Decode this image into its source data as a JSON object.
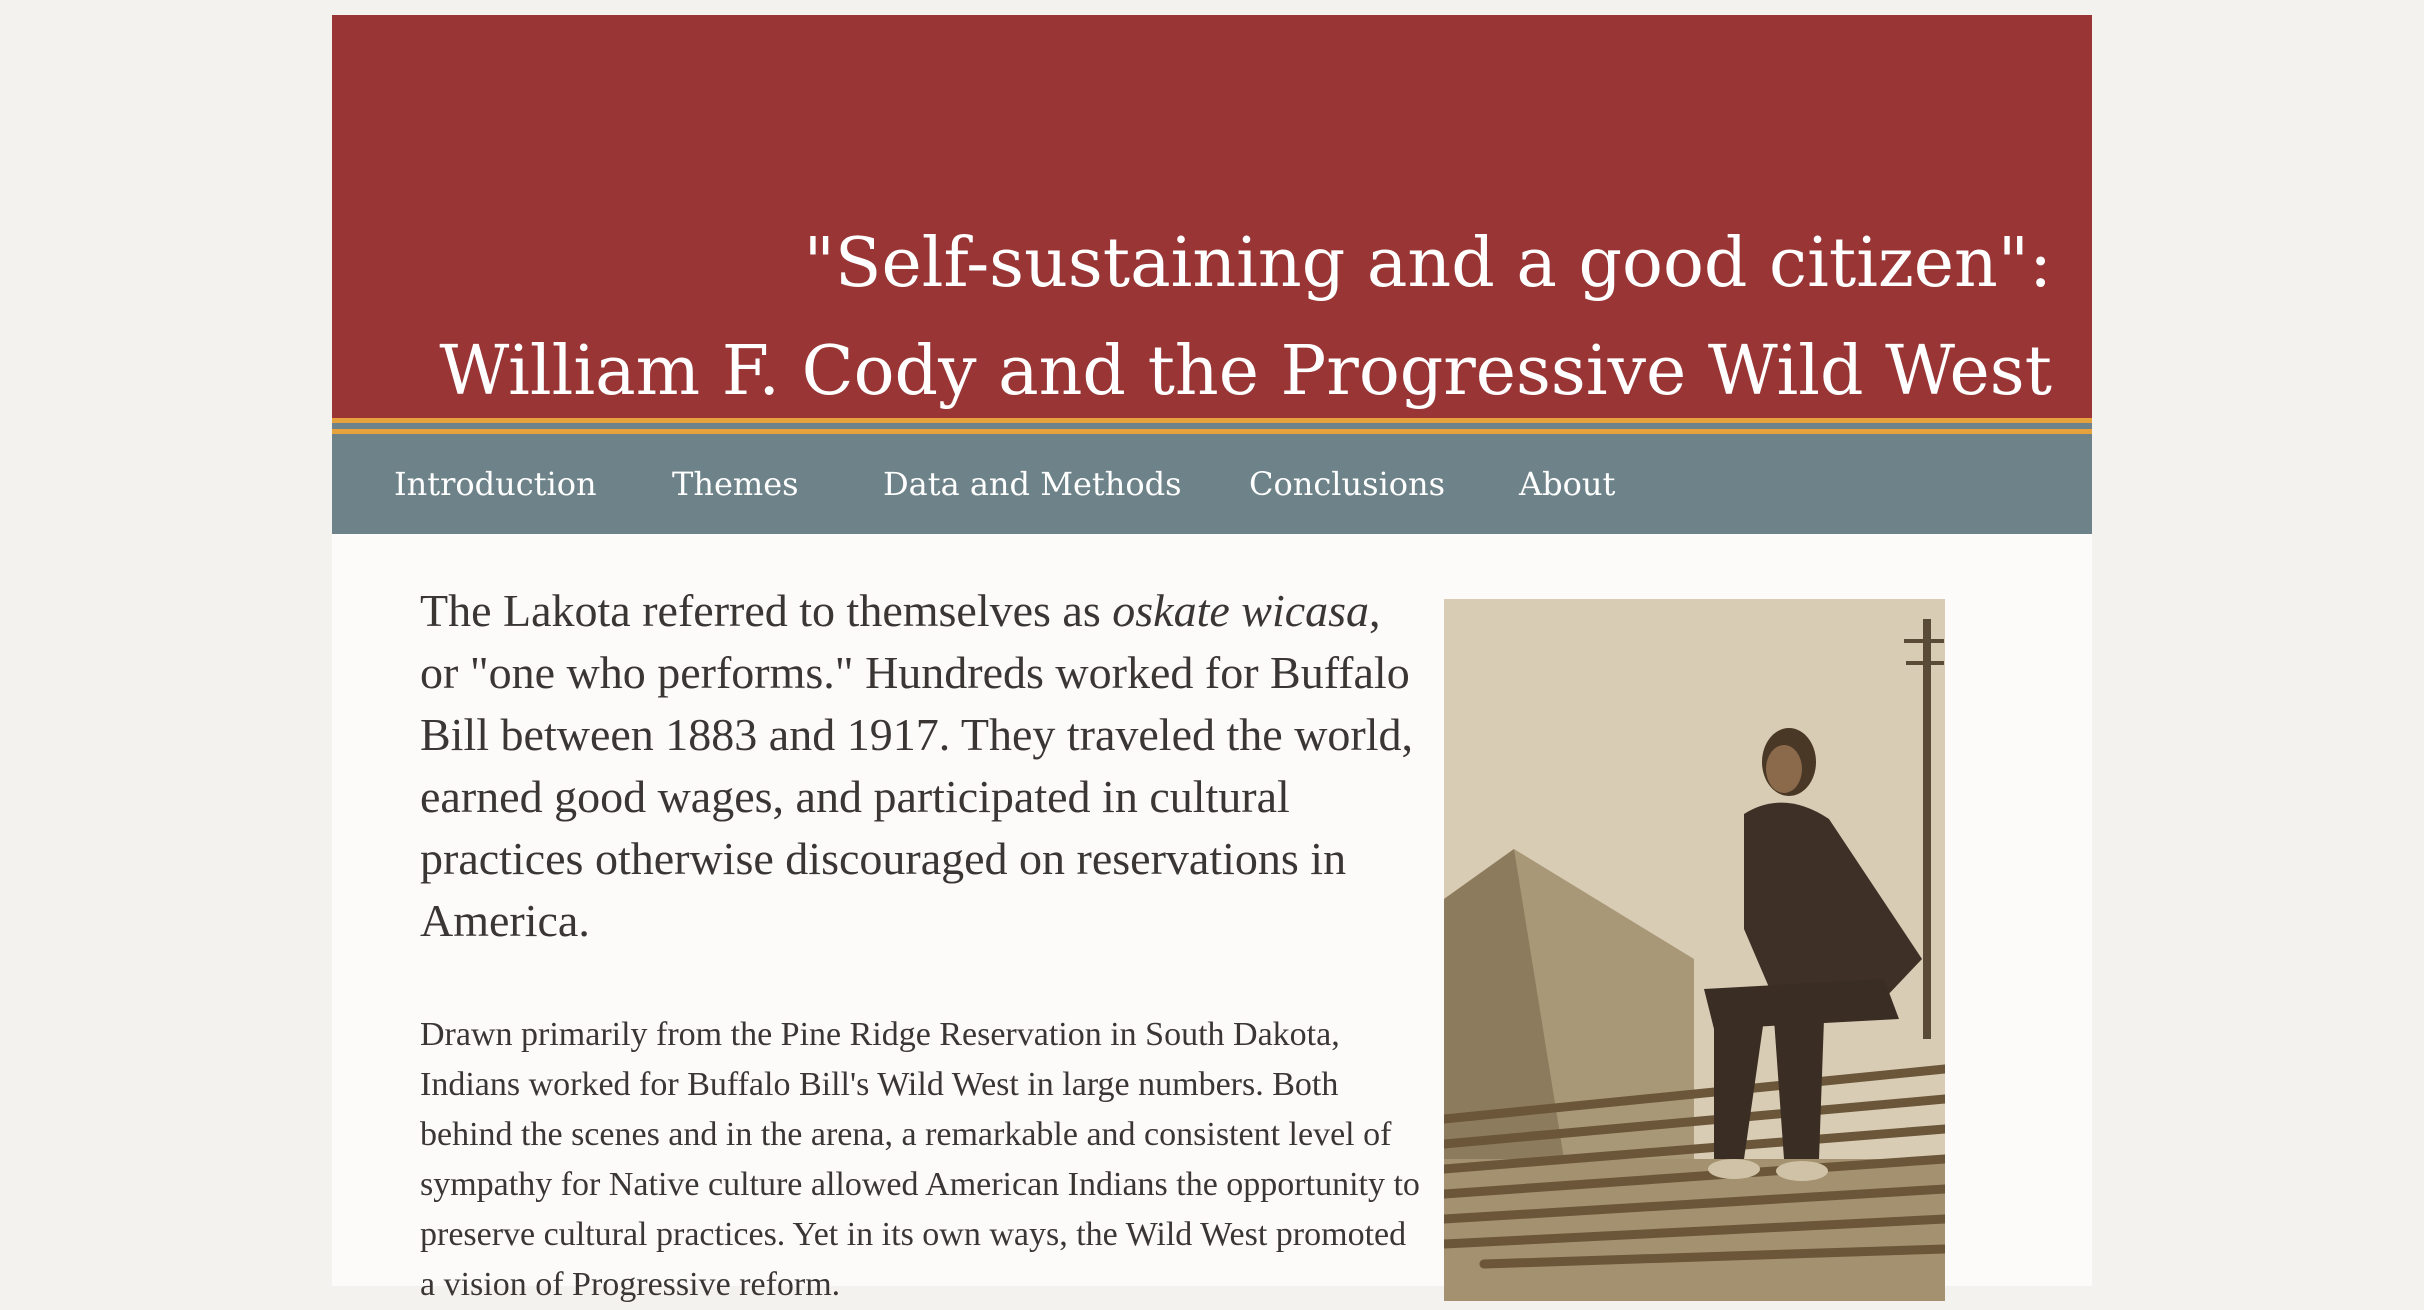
{
  "header": {
    "title_line1": "\"Self-sustaining and a good citizen\":",
    "title_line2": "William F. Cody and the Progressive Wild West"
  },
  "nav": {
    "items": [
      {
        "label": "Introduction"
      },
      {
        "label": "Themes"
      },
      {
        "label": "Data and Methods"
      },
      {
        "label": "Conclusions"
      },
      {
        "label": "About"
      }
    ]
  },
  "main": {
    "lead_before": "The Lakota referred to themselves as ",
    "lead_italic": "oskate wicasa",
    "lead_after": ", or \"one who performs.\" Hundreds worked for Buffalo Bill between 1883 and 1917. They traveled the world, earned good wages, and participated in cultural practices otherwise discouraged on reservations in America.",
    "paragraph": "Drawn primarily from the Pine Ridge Reservation in South Dakota, Indians worked for Buffalo Bill's Wild West in large numbers. Both behind the scenes and in the arena, a remarkable and consistent level of sympathy for Native culture allowed American Indians the opportunity to preserve cultural practices. Yet in its own ways, the Wild West promoted a vision of Progressive reform."
  },
  "colors": {
    "banner": "#993535",
    "stripe": "#e6a23c",
    "nav": "#6e8389",
    "text": "#3a3634",
    "background": "#f3f2ee"
  }
}
